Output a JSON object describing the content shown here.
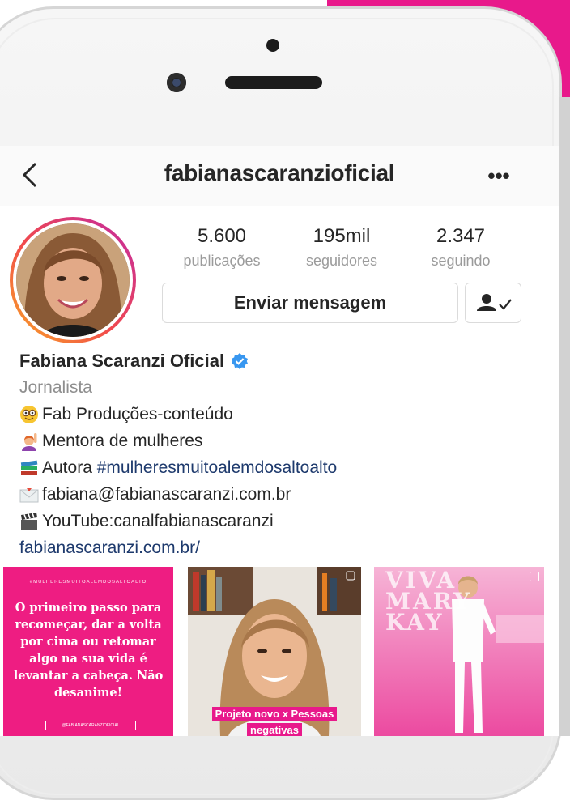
{
  "profile": {
    "username": "fabianascaranzioficial",
    "stats": [
      {
        "value": "5.600",
        "label": "publicações"
      },
      {
        "value": "195mil",
        "label": "seguidores"
      },
      {
        "value": "2.347",
        "label": "seguindo"
      }
    ],
    "message_button": "Enviar mensagem",
    "display_name": "Fabiana Scaranzi Oficial",
    "category": "Jornalista",
    "bio_lines": [
      {
        "icon": "nerd-face-emoji",
        "text": "Fab Produções-conteúdo"
      },
      {
        "icon": "woman-raising-hand-emoji",
        "text": "Mentora de mulheres"
      },
      {
        "icon": "books-emoji",
        "prefix": "Autora ",
        "hashtag": "#mulheresmuitoalemdosaltoalto"
      },
      {
        "icon": "envelope-emoji",
        "text": "fabiana@fabianascaranzi.com.br"
      },
      {
        "icon": "clapper-board-emoji",
        "text": "YouTube:canalfabianascaranzi"
      }
    ],
    "website": "fabianascaranzi.com.br/"
  },
  "posts": [
    {
      "top_text": "#MULHERESMUITOALEMDOSALTOALTO",
      "quote": "O primeiro passo para recomeçar, dar a volta por cima ou retomar algo na sua vida é levantar a cabeça. Não desanime!",
      "handle": "@FABIANASCARANZIOFICIAL"
    },
    {
      "caption": "Projeto novo x Pessoas negativas"
    },
    {
      "overlay_text": "VIVA\nMARY\nKAY"
    }
  ],
  "colors": {
    "accent_pink": "#e8198b",
    "link_blue": "#1e3a6d",
    "verified_blue": "#3897f0"
  }
}
